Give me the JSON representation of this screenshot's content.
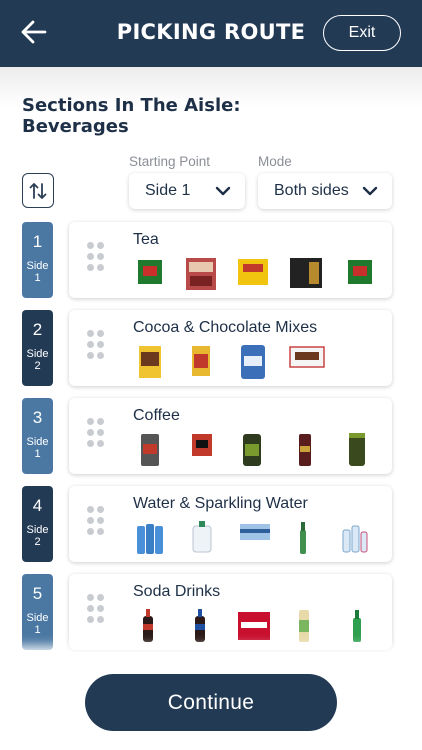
{
  "header": {
    "title": "PICKING ROUTE",
    "exit_label": "Exit"
  },
  "aisle": {
    "title_line1": "Sections In The Aisle:",
    "title_line2": "Beverages"
  },
  "controls": {
    "starting_point_label": "Starting Point",
    "starting_point_value": "Side 1",
    "mode_label": "Mode",
    "mode_value": "Both sides"
  },
  "sections": [
    {
      "number": "1",
      "side": "Side 1",
      "name": "Tea",
      "badge_color": "#4a78a3"
    },
    {
      "number": "2",
      "side": "Side 2",
      "name": "Cocoa & Chocolate Mixes",
      "badge_color": "#233a55"
    },
    {
      "number": "3",
      "side": "Side 1",
      "name": "Coffee",
      "badge_color": "#4a78a3"
    },
    {
      "number": "4",
      "side": "Side 2",
      "name": "Water & Sparkling Water",
      "badge_color": "#233a55"
    },
    {
      "number": "5",
      "side": "Side 1",
      "name": "Soda Drinks",
      "badge_color": "#4a78a3"
    }
  ],
  "footer": {
    "continue_label": "Continue"
  }
}
